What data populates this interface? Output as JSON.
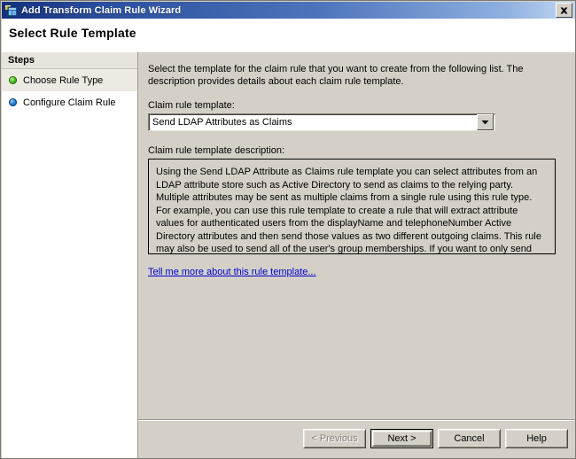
{
  "window": {
    "title": "Add Transform Claim Rule Wizard",
    "icon": "wizard-window-icon",
    "close_label": "close-icon"
  },
  "header": {
    "page_title": "Select Rule Template"
  },
  "sidebar": {
    "header": "Steps",
    "items": [
      {
        "label": "Choose Rule Type",
        "state": "completed",
        "dot_color": "#3fb91c"
      },
      {
        "label": "Configure Claim Rule",
        "state": "current",
        "dot_color": "#1f78d1"
      }
    ]
  },
  "main": {
    "intro": "Select the template for the claim rule that you want to create from the following list. The description provides details about each claim rule template.",
    "combo_label": "Claim rule template:",
    "combo_value": "Send LDAP Attributes as Claims",
    "combo_options": [
      "Send LDAP Attributes as Claims"
    ],
    "description_label": "Claim rule template description:",
    "description": "Using the Send LDAP Attribute as Claims rule template you can select attributes from an LDAP attribute store such as Active Directory to send as claims to the relying party. Multiple attributes may be sent as multiple claims from a single rule using this rule type. For example, you can use this rule template to create a rule that will extract attribute values for authenticated users from the displayName and telephoneNumber Active Directory attributes and then send those values as two different outgoing claims. This rule may also be used to send all of the user's group memberships. If you want to only send individual group memberships, use the Send Group Membership as a Claim rule template.",
    "more_link": "Tell me more about this rule template..."
  },
  "footer": {
    "previous_label": "< Previous",
    "next_label": "Next >",
    "cancel_label": "Cancel",
    "help_label": "Help"
  },
  "colors": {
    "titlebar_start": "#13307c",
    "titlebar_end": "#c3d8f2",
    "dialog_face": "#d4d0c8",
    "link": "#0000d0"
  }
}
